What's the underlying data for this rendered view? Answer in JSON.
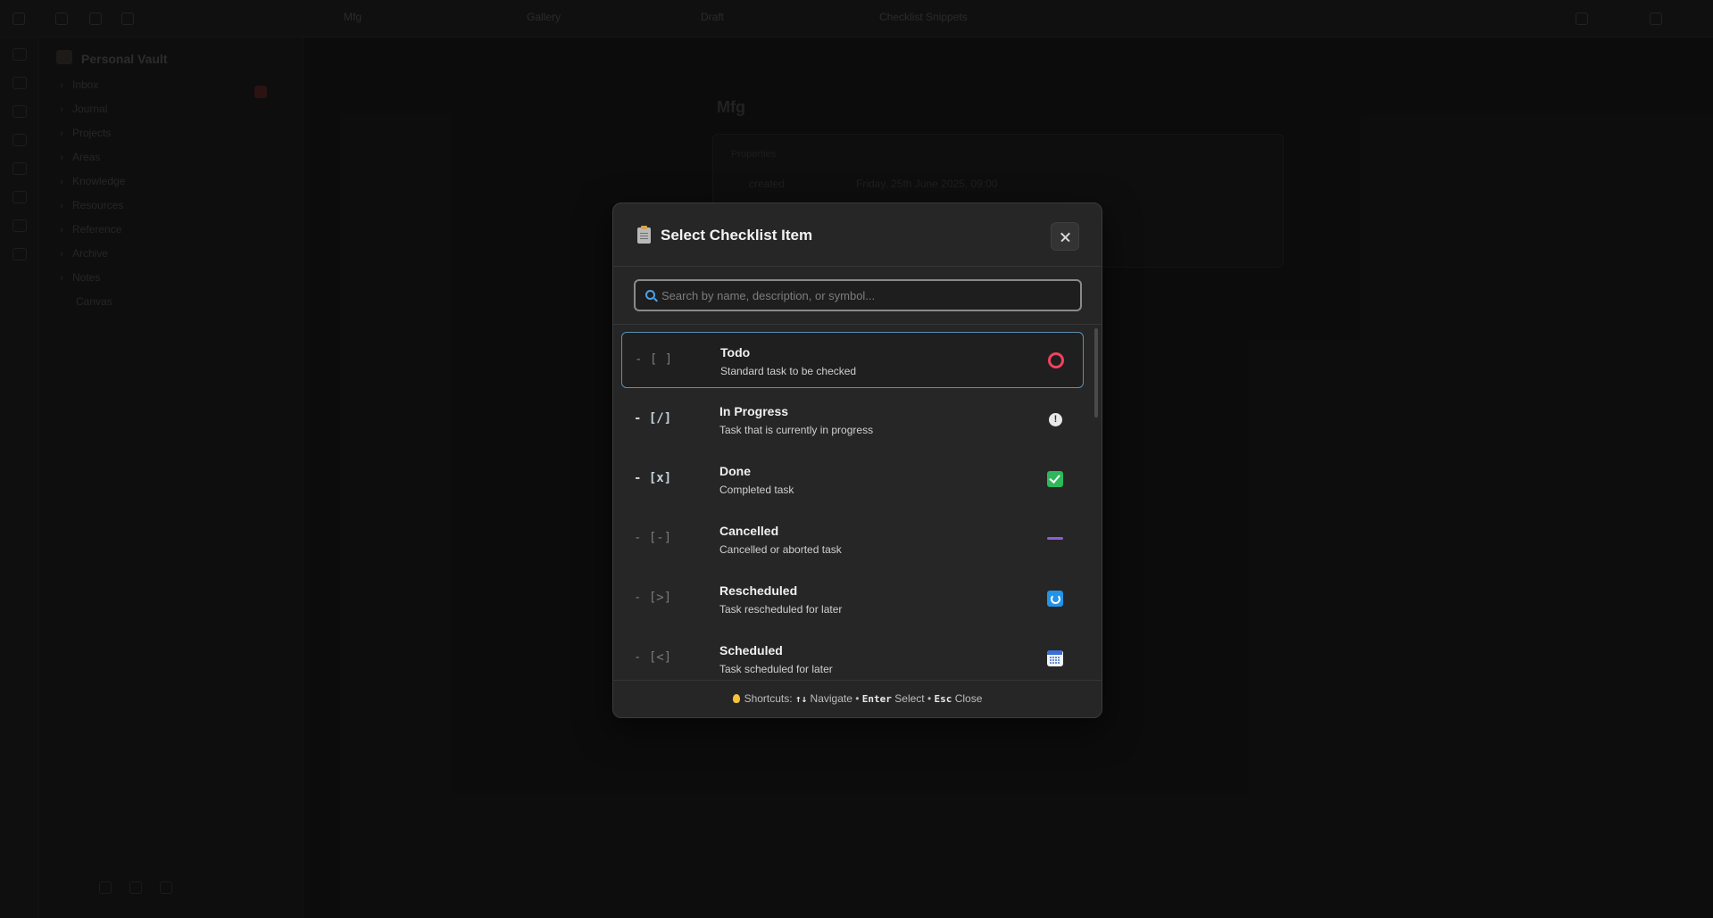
{
  "background": {
    "vault_name": "Personal Vault",
    "tabs": [
      "Mfg",
      "Gallery",
      "Draft",
      "Checklist Snippets"
    ],
    "folders": [
      "Inbox",
      "Journal",
      "Projects",
      "Areas",
      "Knowledge",
      "Resources",
      "Reference",
      "Archive",
      "Notes",
      "Canvas"
    ],
    "doc_title": "Mfg",
    "props_header": "Properties",
    "prop_key": "created",
    "prop_value": "Friday, 25th June 2025, 09:00"
  },
  "modal": {
    "title": "Select Checklist Item",
    "search_placeholder": "Search by name, description, or symbol...",
    "items": [
      {
        "symbol": "- [ ]",
        "name": "Todo",
        "description": "Standard task to be checked",
        "icon": "red-circle-icon",
        "selected": true
      },
      {
        "symbol": "- [/]",
        "name": "In Progress",
        "description": "Task that is currently in progress",
        "icon": "exclamation-icon",
        "selected": false
      },
      {
        "symbol": "- [x]",
        "name": "Done",
        "description": "Completed task",
        "icon": "green-check-icon",
        "selected": false
      },
      {
        "symbol": "- [-]",
        "name": "Cancelled",
        "description": "Cancelled or aborted task",
        "icon": "purple-dash-icon",
        "selected": false
      },
      {
        "symbol": "- [>]",
        "name": "Rescheduled",
        "description": "Task rescheduled for later",
        "icon": "refresh-icon",
        "selected": false
      },
      {
        "symbol": "- [<]",
        "name": "Scheduled",
        "description": "Task scheduled for later",
        "icon": "calendar-icon",
        "selected": false
      }
    ],
    "footer": {
      "shortcuts_label": "Shortcuts:",
      "navigate_key": "↑↓",
      "navigate_label": "Navigate •",
      "select_key": "Enter",
      "select_label": "Select •",
      "close_key": "Esc",
      "close_label": "Close"
    }
  },
  "colors": {
    "todo": "#f2415e",
    "done": "#2eb85c",
    "cancelled": "#8a5fd6",
    "rescheduled": "#2393e8",
    "selection_border": "#5d8fb0"
  }
}
